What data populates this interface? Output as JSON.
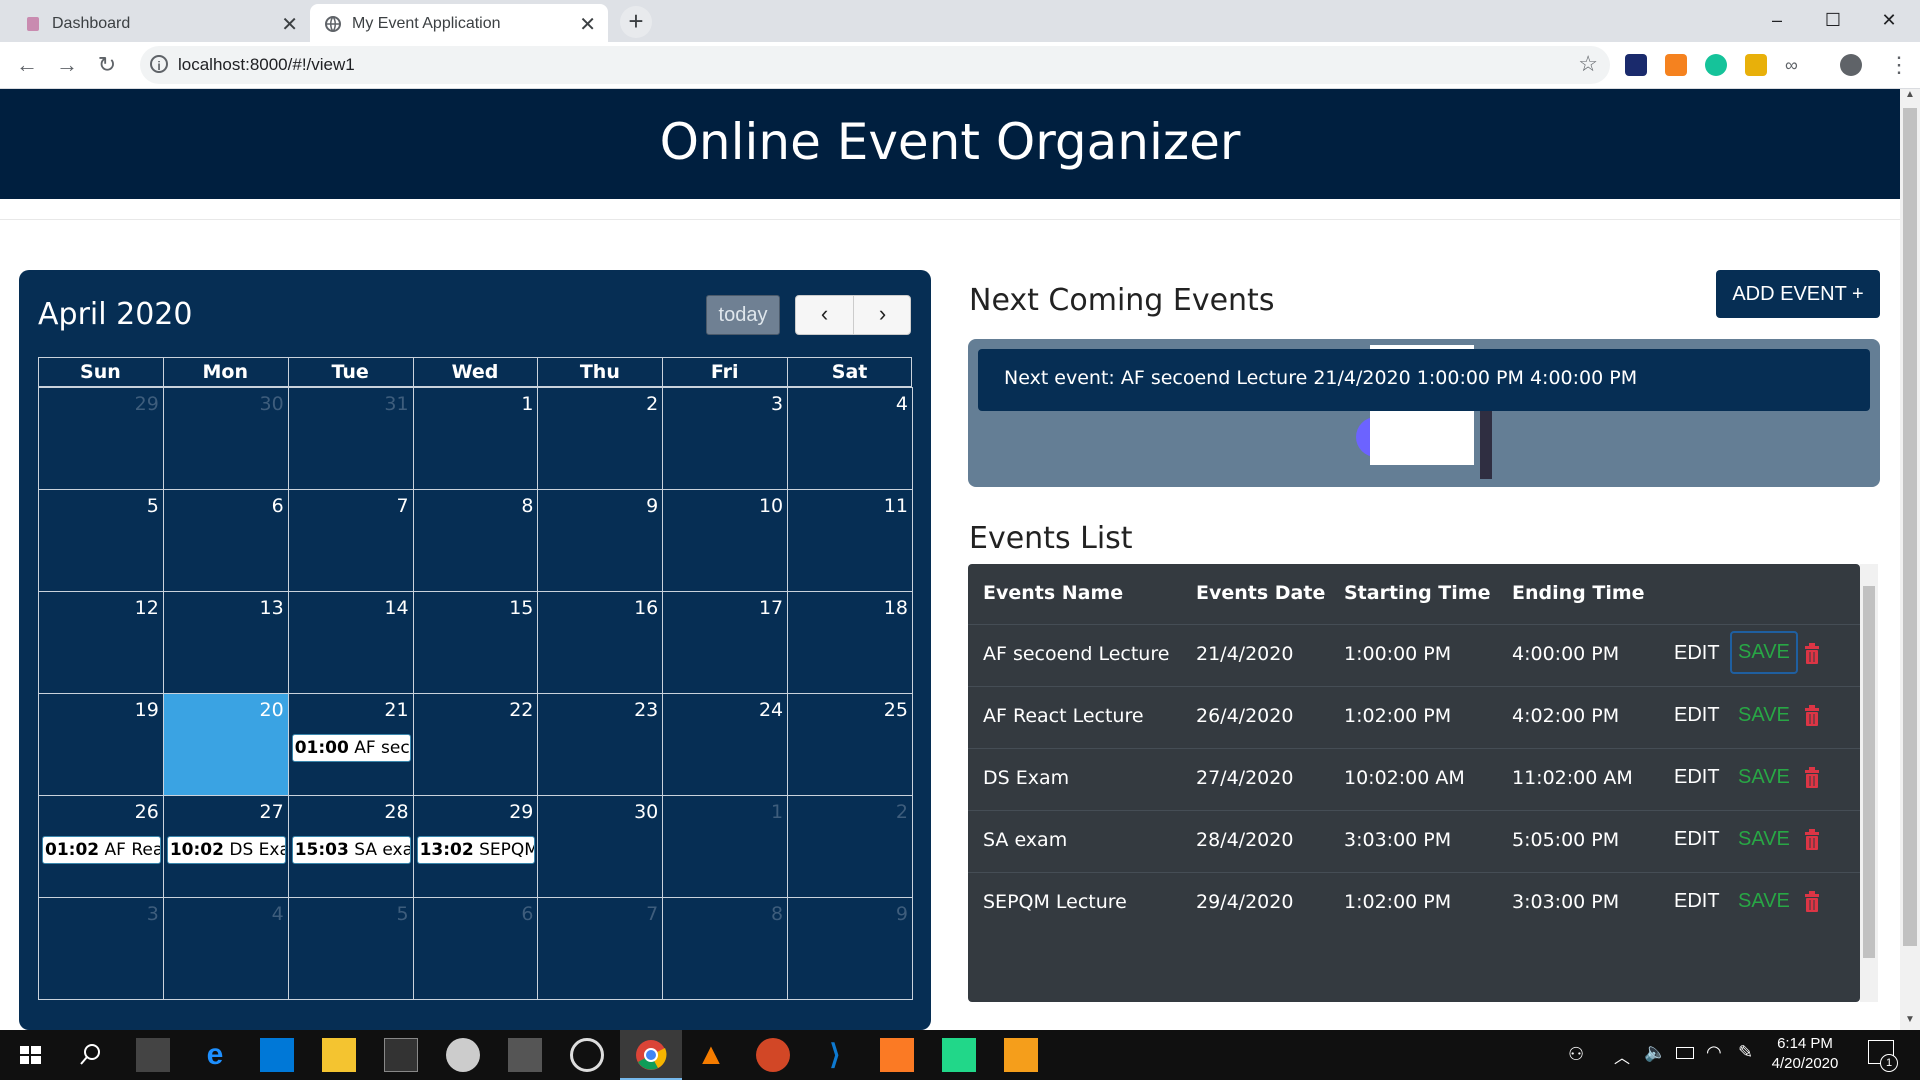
{
  "browser": {
    "tabs": [
      {
        "label": "Dashboard",
        "active": false
      },
      {
        "label": "My Event Application",
        "active": true
      }
    ],
    "new_tab": "+",
    "url": "localhost:8000/#!/view1",
    "window_controls": {
      "minimize": "–",
      "maximize": "☐",
      "close": "✕"
    },
    "nav": {
      "back": "←",
      "forward": "→",
      "reload": "↻",
      "star": "☆"
    }
  },
  "header": {
    "title": "Online Event Organizer"
  },
  "calendar": {
    "month_title": "April 2020",
    "today_label": "today",
    "prev": "‹",
    "next": "›",
    "day_headers": [
      "Sun",
      "Mon",
      "Tue",
      "Wed",
      "Thu",
      "Fri",
      "Sat"
    ],
    "weeks": [
      [
        {
          "d": "29",
          "o": true
        },
        {
          "d": "30",
          "o": true
        },
        {
          "d": "31",
          "o": true
        },
        {
          "d": "1"
        },
        {
          "d": "2"
        },
        {
          "d": "3"
        },
        {
          "d": "4"
        }
      ],
      [
        {
          "d": "5"
        },
        {
          "d": "6"
        },
        {
          "d": "7"
        },
        {
          "d": "8"
        },
        {
          "d": "9"
        },
        {
          "d": "10"
        },
        {
          "d": "11"
        }
      ],
      [
        {
          "d": "12"
        },
        {
          "d": "13"
        },
        {
          "d": "14"
        },
        {
          "d": "15"
        },
        {
          "d": "16"
        },
        {
          "d": "17"
        },
        {
          "d": "18"
        }
      ],
      [
        {
          "d": "19"
        },
        {
          "d": "20",
          "today": true
        },
        {
          "d": "21",
          "time": "01:00",
          "title": "AF secoe"
        },
        {
          "d": "22"
        },
        {
          "d": "23"
        },
        {
          "d": "24"
        },
        {
          "d": "25"
        }
      ],
      [
        {
          "d": "26",
          "time": "01:02",
          "title": "AF React"
        },
        {
          "d": "27",
          "time": "10:02",
          "title": "DS Exam"
        },
        {
          "d": "28",
          "time": "15:03",
          "title": "SA exam"
        },
        {
          "d": "29",
          "time": "13:02",
          "title": "SEPQM L"
        },
        {
          "d": "30"
        },
        {
          "d": "1",
          "o": true
        },
        {
          "d": "2",
          "o": true
        }
      ],
      [
        {
          "d": "3",
          "o": true
        },
        {
          "d": "4",
          "o": true
        },
        {
          "d": "5",
          "o": true
        },
        {
          "d": "6",
          "o": true
        },
        {
          "d": "7",
          "o": true
        },
        {
          "d": "8",
          "o": true
        },
        {
          "d": "9",
          "o": true
        }
      ]
    ]
  },
  "next_events": {
    "title": "Next Coming Events",
    "add_button": "ADD EVENT +",
    "next_text": "Next event: AF secoend Lecture 21/4/2020 1:00:00 PM 4:00:00 PM"
  },
  "events_list": {
    "title": "Events List",
    "columns": [
      "Events Name",
      "Events Date",
      "Starting Time",
      "Ending Time"
    ],
    "edit_label": "EDIT",
    "save_label": "SAVE",
    "rows": [
      {
        "name": "AF secoend Lecture",
        "date": "21/4/2020",
        "start": "1:00:00 PM",
        "end": "4:00:00 PM"
      },
      {
        "name": "AF React Lecture",
        "date": "26/4/2020",
        "start": "1:02:00 PM",
        "end": "4:02:00 PM"
      },
      {
        "name": "DS Exam",
        "date": "27/4/2020",
        "start": "10:02:00 AM",
        "end": "11:02:00 AM"
      },
      {
        "name": "SA exam",
        "date": "28/4/2020",
        "start": "3:03:00 PM",
        "end": "5:05:00 PM"
      },
      {
        "name": "SEPQM Lecture",
        "date": "29/4/2020",
        "start": "1:02:00 PM",
        "end": "3:03:00 PM"
      }
    ]
  },
  "taskbar": {
    "time": "6:14 PM",
    "date": "4/20/2020",
    "notification_count": "1"
  },
  "colors": {
    "header": "#001f3f",
    "panel": "#062e54",
    "today": "#3aa3e3",
    "save": "#28a745",
    "delete": "#dc3545"
  }
}
